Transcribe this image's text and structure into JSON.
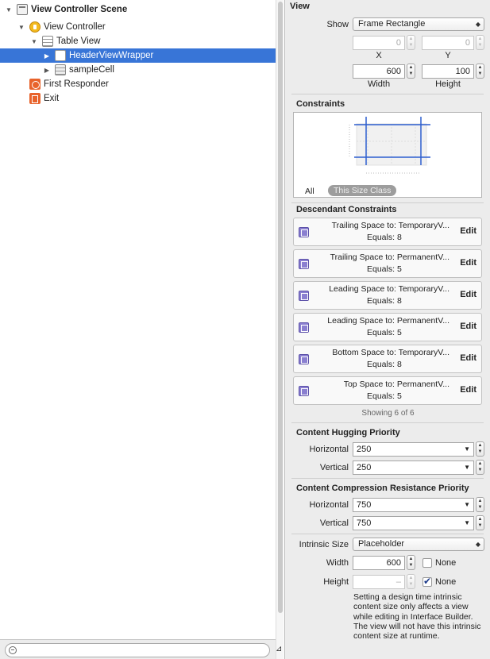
{
  "outline": {
    "items": [
      {
        "label": "View Controller Scene",
        "bold": true
      },
      {
        "label": "View Controller"
      },
      {
        "label": "Table View"
      },
      {
        "label": "HeaderViewWrapper"
      },
      {
        "label": "sampleCell"
      },
      {
        "label": "First Responder"
      },
      {
        "label": "Exit"
      }
    ],
    "selected": "HeaderViewWrapper"
  },
  "inspector": {
    "view": {
      "title": "View",
      "show_label": "Show",
      "show_value": "Frame Rectangle",
      "x_value": "0",
      "y_value": "0",
      "x_label": "X",
      "y_label": "Y",
      "width_value": "600",
      "height_value": "100",
      "width_label": "Width",
      "height_label": "Height"
    },
    "constraints": {
      "title": "Constraints",
      "tab_all": "All",
      "tab_size_class": "This Size Class"
    },
    "descendant": {
      "title": "Descendant Constraints",
      "items": [
        {
          "line1": "Trailing Space to:  TemporaryV...",
          "line2": "Equals:  8",
          "edit": "Edit"
        },
        {
          "line1": "Trailing Space to:  PermanentV...",
          "line2": "Equals:  5",
          "edit": "Edit"
        },
        {
          "line1": "Leading Space to:  TemporaryV...",
          "line2": "Equals:  8",
          "edit": "Edit"
        },
        {
          "line1": "Leading Space to:  PermanentV...",
          "line2": "Equals:  5",
          "edit": "Edit"
        },
        {
          "line1": "Bottom Space to:  TemporaryV...",
          "line2": "Equals:  8",
          "edit": "Edit"
        },
        {
          "line1": "Top Space to:  PermanentV...",
          "line2": "Equals:  5",
          "edit": "Edit"
        }
      ],
      "showing": "Showing 6 of 6"
    },
    "hugging": {
      "title": "Content Hugging Priority",
      "horizontal_label": "Horizontal",
      "horizontal_value": "250",
      "vertical_label": "Vertical",
      "vertical_value": "250"
    },
    "compression": {
      "title": "Content Compression Resistance Priority",
      "horizontal_label": "Horizontal",
      "horizontal_value": "750",
      "vertical_label": "Vertical",
      "vertical_value": "750"
    },
    "intrinsic": {
      "label": "Intrinsic Size",
      "value": "Placeholder",
      "width_label": "Width",
      "width_value": "600",
      "width_none_label": "None",
      "width_none_checked": false,
      "height_label": "Height",
      "height_value": "–",
      "height_none_label": "None",
      "height_none_checked": true,
      "note": "Setting a design time intrinsic content size only affects a view while editing in Interface Builder. The view will not have this intrinsic content size at runtime."
    }
  },
  "colors": {
    "selection": "#3875d7",
    "constraint_blue": "#2e5fcf"
  }
}
